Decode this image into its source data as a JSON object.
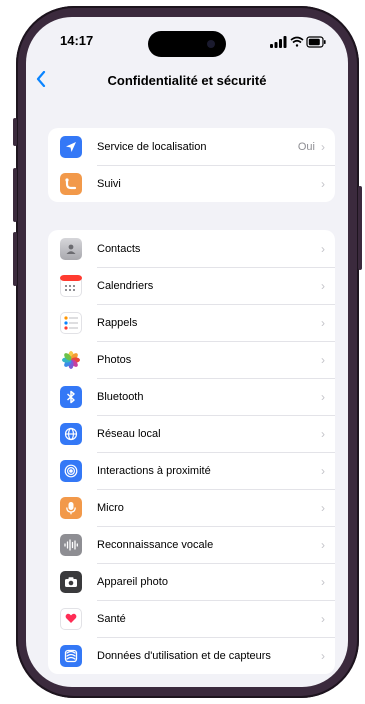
{
  "status_bar": {
    "time": "14:17",
    "icons": [
      "signal-icon",
      "wifi-icon",
      "battery-icon"
    ]
  },
  "nav": {
    "back_icon": "chevron-left-icon",
    "title": "Confidentialité et sécurité"
  },
  "group1": [
    {
      "label": "Service de localisation",
      "value": "Oui",
      "icon": "location-arrow-icon",
      "color": "#3478f6"
    },
    {
      "label": "Suivi",
      "value": "",
      "icon": "tracking-icon",
      "color": "#f2994a"
    }
  ],
  "group2": [
    {
      "label": "Contacts",
      "icon": "contacts-icon",
      "color": "#b4b4b9"
    },
    {
      "label": "Calendriers",
      "icon": "calendar-icon",
      "color": "#ffffff"
    },
    {
      "label": "Rappels",
      "icon": "reminders-icon",
      "color": "#ffffff"
    },
    {
      "label": "Photos",
      "icon": "photos-icon",
      "color": "#ffffff"
    },
    {
      "label": "Bluetooth",
      "icon": "bluetooth-icon",
      "color": "#3478f6"
    },
    {
      "label": "Réseau local",
      "icon": "globe-icon",
      "color": "#3478f6"
    },
    {
      "label": "Interactions à proximité",
      "icon": "nearby-interaction-icon",
      "color": "#3478f6"
    },
    {
      "label": "Micro",
      "icon": "microphone-icon",
      "color": "#f2994a"
    },
    {
      "label": "Reconnaissance vocale",
      "icon": "waveform-icon",
      "color": "#8e8e93"
    },
    {
      "label": "Appareil photo",
      "icon": "camera-icon",
      "color": "#3a3a3c"
    },
    {
      "label": "Santé",
      "icon": "heart-icon",
      "color": "#ffffff"
    },
    {
      "label": "Données d'utilisation et de capteurs",
      "icon": "research-icon",
      "color": "#3478f6"
    }
  ]
}
